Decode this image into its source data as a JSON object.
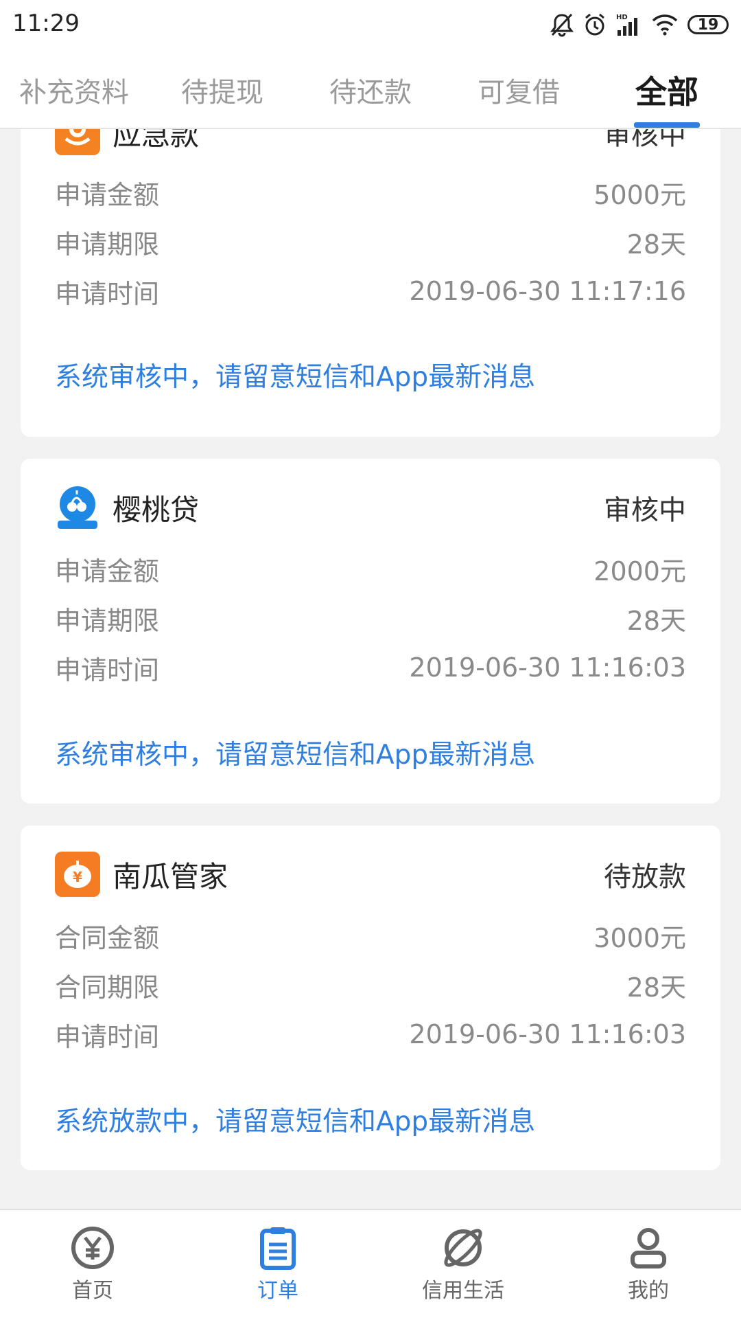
{
  "status_bar": {
    "time": "11:29",
    "battery": "19"
  },
  "tabs": [
    {
      "label": "补充资料",
      "active": false
    },
    {
      "label": "待提现",
      "active": false
    },
    {
      "label": "待还款",
      "active": false
    },
    {
      "label": "可复借",
      "active": false
    },
    {
      "label": "全部",
      "active": true
    }
  ],
  "orders": [
    {
      "name": "应急款",
      "status": "审核中",
      "logo_color": "#f58220",
      "rows": [
        {
          "label": "申请金额",
          "value": "5000元"
        },
        {
          "label": "申请期限",
          "value": "28天"
        },
        {
          "label": "申请时间",
          "value": "2019-06-30 11:17:16"
        }
      ],
      "note": "系统审核中，请留意短信和App最新消息"
    },
    {
      "name": "樱桃贷",
      "status": "审核中",
      "logo_color": "#1e88e5",
      "logo_caption": "樱桃贷",
      "rows": [
        {
          "label": "申请金额",
          "value": "2000元"
        },
        {
          "label": "申请期限",
          "value": "28天"
        },
        {
          "label": "申请时间",
          "value": "2019-06-30 11:16:03"
        }
      ],
      "note": "系统审核中，请留意短信和App最新消息"
    },
    {
      "name": "南瓜管家",
      "status": "待放款",
      "logo_color": "#f57c22",
      "rows": [
        {
          "label": "合同金额",
          "value": "3000元"
        },
        {
          "label": "合同期限",
          "value": "28天"
        },
        {
          "label": "申请时间",
          "value": "2019-06-30 11:16:03"
        }
      ],
      "note": "系统放款中，请留意短信和App最新消息"
    }
  ],
  "bottom_nav": [
    {
      "label": "首页",
      "icon": "yuan-coin-icon",
      "active": false
    },
    {
      "label": "订单",
      "icon": "clipboard-icon",
      "active": true
    },
    {
      "label": "信用生活",
      "icon": "planet-icon",
      "active": false
    },
    {
      "label": "我的",
      "icon": "person-icon",
      "active": false
    }
  ],
  "colors": {
    "accent": "#2f7fe0",
    "background": "#f2f2f2"
  }
}
